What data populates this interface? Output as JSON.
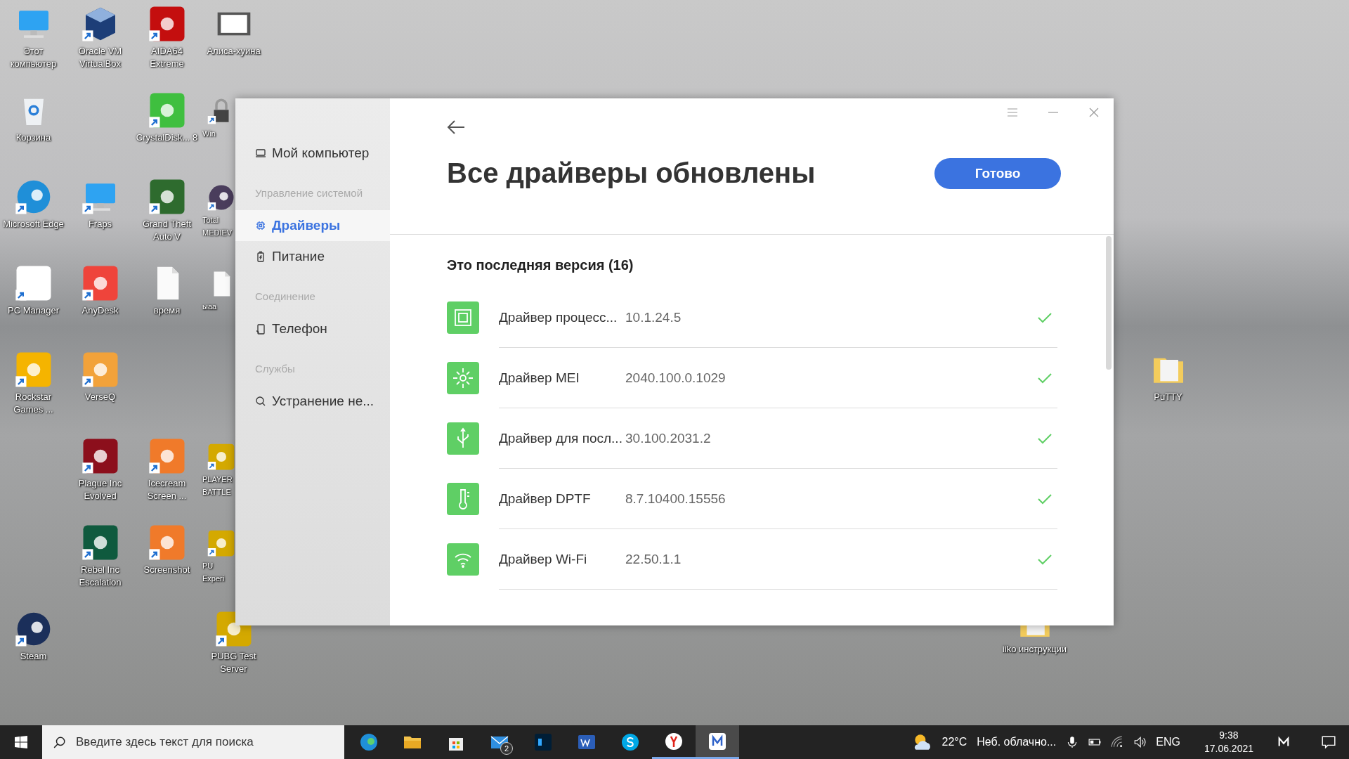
{
  "desktop": {
    "left_columns": [
      [
        {
          "label": "Этот компьютер",
          "kind": "monitor",
          "shortcut": false
        },
        {
          "label": "Корзина",
          "kind": "bin",
          "shortcut": false
        },
        {
          "label": "Microsoft Edge",
          "kind": "swirl",
          "color": "#1f8fd8",
          "shortcut": true
        },
        {
          "label": "PC Manager",
          "kind": "tile",
          "color": "#ffffff",
          "shortcut": true
        },
        {
          "label": "Rockstar Games ...",
          "kind": "tile",
          "color": "#f5b400",
          "shortcut": true
        },
        null,
        null,
        {
          "label": "Steam",
          "kind": "swirl",
          "color": "#1b2f5a",
          "shortcut": true
        }
      ],
      [
        {
          "label": "Oracle VM VirtualBox",
          "kind": "cube",
          "shortcut": true
        },
        null,
        {
          "label": "Fraps",
          "kind": "monitor",
          "shortcut": true
        },
        {
          "label": "AnyDesk",
          "kind": "tile",
          "color": "#ef443b",
          "shortcut": true
        },
        {
          "label": "VerseQ",
          "kind": "tile",
          "color": "#f2a23a",
          "shortcut": true
        },
        {
          "label": "Plague Inc Evolved",
          "kind": "tile",
          "color": "#8c0f1c",
          "shortcut": true
        },
        {
          "label": "Rebel Inc Escalation",
          "kind": "tile",
          "color": "#0f5a3e",
          "shortcut": true
        },
        null
      ],
      [
        {
          "label": "AIDA64 Extreme",
          "kind": "tile",
          "color": "#c40e0e",
          "shortcut": true
        },
        {
          "label": "CrystalDisk... 8",
          "kind": "tile",
          "color": "#3fbf3f",
          "shortcut": true
        },
        {
          "label": "Grand Theft Auto V",
          "kind": "tile",
          "color": "#2e6b2e",
          "shortcut": true
        },
        {
          "label": "время",
          "kind": "document",
          "shortcut": false
        },
        null,
        {
          "label": "Icecream Screen ...",
          "kind": "tile",
          "color": "#f07a2a",
          "shortcut": true
        },
        {
          "label": "Screenshot",
          "kind": "tile",
          "color": "#f07a2a",
          "shortcut": true
        },
        null
      ],
      [
        {
          "label": "Алиса-хуина",
          "kind": "film",
          "shortcut": false
        },
        {
          "label": "Win",
          "kind": "padlock",
          "shortcut": true,
          "partial": true
        },
        {
          "label": "Total MEDIEV",
          "kind": "swirl",
          "color": "#4a3d5c",
          "shortcut": true,
          "partial": true
        },
        {
          "label": "ыаа",
          "kind": "document",
          "shortcut": false,
          "partial": true
        },
        null,
        {
          "label": "PLAYER BATTLE",
          "kind": "tile",
          "color": "#d4a900",
          "shortcut": true,
          "partial": true
        },
        {
          "label": "PU Experi",
          "kind": "tile",
          "color": "#d4a900",
          "shortcut": true,
          "partial": true
        },
        {
          "label": "PUBG Test Server",
          "kind": "tile",
          "color": "#d4a900",
          "shortcut": true
        }
      ]
    ],
    "right_columns": [
      [
        null,
        null,
        null,
        null,
        null,
        null,
        null,
        {
          "label": "iiko инструкции",
          "kind": "folder",
          "shortcut": false,
          "partial": true
        }
      ],
      [
        null,
        null,
        null,
        null,
        {
          "label": "PuTTY",
          "kind": "folder",
          "shortcut": false
        }
      ]
    ]
  },
  "window": {
    "sidebar": [
      {
        "kind": "item",
        "label": "Мой компьютер",
        "selected": false
      },
      {
        "kind": "heading",
        "label": "Управление системой"
      },
      {
        "kind": "item",
        "label": "Драйверы",
        "selected": true
      },
      {
        "kind": "item",
        "label": "Питание",
        "selected": false
      },
      {
        "kind": "heading",
        "label": "Соединение"
      },
      {
        "kind": "item",
        "label": "Телефон",
        "selected": false
      },
      {
        "kind": "heading",
        "label": "Службы"
      },
      {
        "kind": "item",
        "label": "Устранение не...",
        "selected": false
      }
    ],
    "title": "Все драйверы обновлены",
    "done_button": "Готово",
    "section_title": "Это последняя версия (16)",
    "drivers": [
      {
        "kind": "chip",
        "name": "Драйвер процесс...",
        "version": "10.1.24.5",
        "updated": true
      },
      {
        "kind": "target",
        "name": "Драйвер MEI",
        "version": "2040.100.0.1029",
        "updated": true
      },
      {
        "kind": "usb",
        "name": "Драйвер для посл...",
        "version": "30.100.2031.2",
        "updated": true
      },
      {
        "kind": "thermometer",
        "name": "Драйвер DPTF",
        "version": "8.7.10400.15556",
        "updated": true
      },
      {
        "kind": "wifi",
        "name": "Драйвер Wi-Fi",
        "version": "22.50.1.1",
        "updated": true
      }
    ]
  },
  "taskbar": {
    "search": {
      "placeholder": "Введите здесь текст для поиска"
    },
    "apps": [
      {
        "kind": "edge",
        "running": false,
        "focused": false
      },
      {
        "kind": "folder",
        "running": false,
        "focused": false
      },
      {
        "kind": "store",
        "running": false,
        "focused": false
      },
      {
        "kind": "mail",
        "running": false,
        "focused": false,
        "badge": "2"
      },
      {
        "kind": "ps",
        "running": false,
        "focused": false
      },
      {
        "kind": "word",
        "running": false,
        "focused": false
      },
      {
        "kind": "skype",
        "running": false,
        "focused": false
      },
      {
        "kind": "yandex",
        "running": true,
        "focused": false
      },
      {
        "kind": "pcm",
        "running": true,
        "focused": true
      }
    ],
    "temperature": "22°C",
    "weather": "Неб. облачно...",
    "language": "ENG",
    "time": "9:38",
    "date": "17.06.2021"
  }
}
